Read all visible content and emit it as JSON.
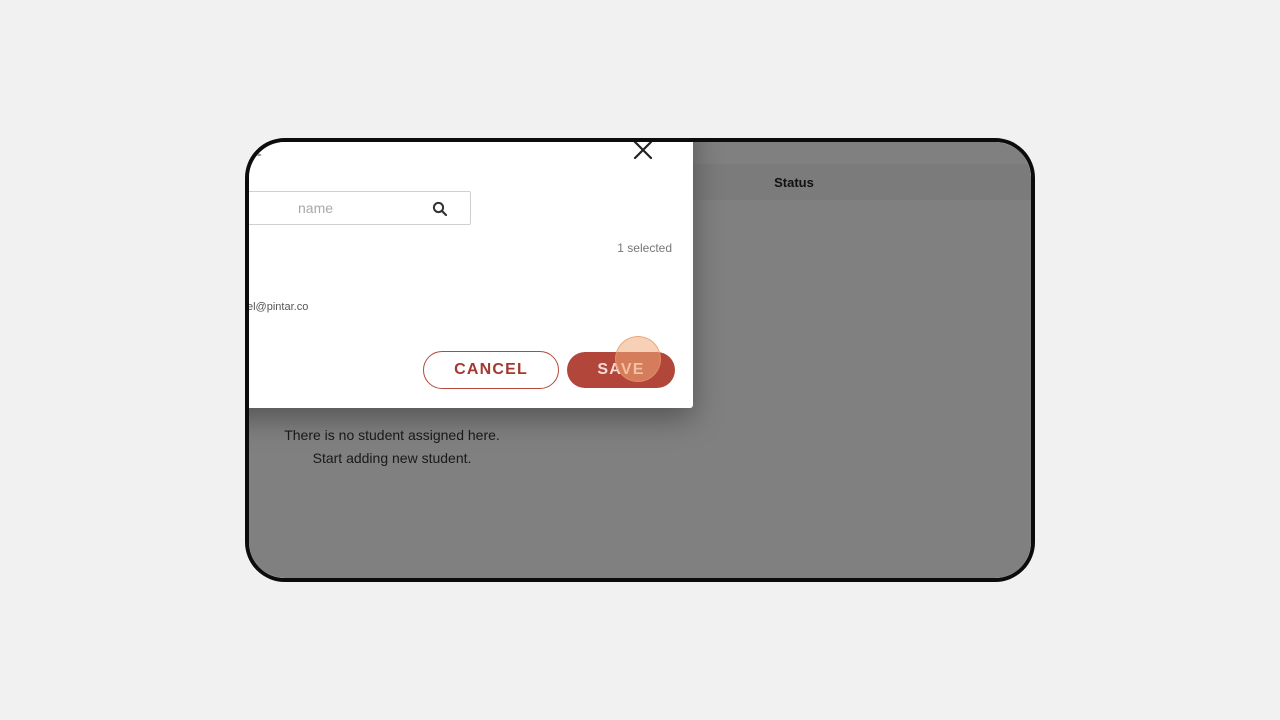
{
  "table": {
    "status_header": "Status"
  },
  "empty_state": {
    "line1": "There is no student assigned here.",
    "line2": "Start adding new student."
  },
  "modal": {
    "title_fragment": "ent",
    "search": {
      "placeholder": "name"
    },
    "selected_count": "1 selected",
    "student_email": "el@pintar.co",
    "cancel_label": "CANCEL",
    "save_label": "SAVE"
  },
  "icons": {
    "close": "close-icon",
    "search": "search-icon"
  },
  "colors": {
    "accent": "#b3463b",
    "overlay": "#808080",
    "click_indicator": "#f0aa78"
  }
}
